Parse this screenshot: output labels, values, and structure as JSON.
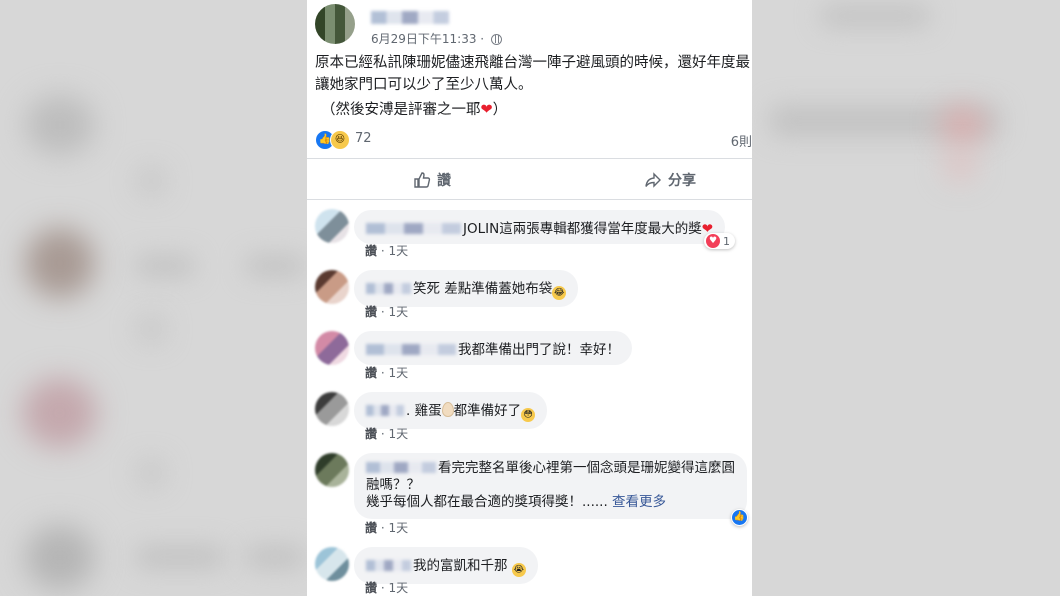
{
  "post": {
    "timestamp": "6月29日下午11:33 · ",
    "text_line1": "原本已經私訊陳珊妮儘速飛離台灣一陣子避風頭的時候，還好年度最",
    "text_line2": "讓她家門口可以少了至少八萬人。",
    "text_line3": "（然後安溥是評審之一耶",
    "text_line3_end": "）",
    "heart_glyph": "❤",
    "reaction_count": "72",
    "share_count": "6則"
  },
  "actions": {
    "like_label": "讚",
    "share_label": "分享"
  },
  "comments": [
    {
      "text": "JOLIN這兩張專輯都獲得當年度最大的獎",
      "emoji": "❤",
      "like": "讚",
      "time": "1天",
      "reacts": "1"
    },
    {
      "text": "笑死 差點準備蓋她布袋",
      "emoji": "😂",
      "like": "讚",
      "time": "1天"
    },
    {
      "text": "我都準備出門了說！幸好！",
      "like": "讚",
      "time": "1天"
    },
    {
      "text_a": ". 雞蛋",
      "text_b": "都準備好了",
      "emoji": "😳",
      "like": "讚",
      "time": "1天"
    },
    {
      "text_line1": "看完完整名單後心裡第一個念頭是珊妮變得這麼圓",
      "text_line2": "融嗎？？",
      "text_line3": "幾乎每個人都在最合適的獎項得獎！......",
      "see_more": "查看更多",
      "like": "讚",
      "time": "1天"
    },
    {
      "text": "我的富凱和千那",
      "emoji": "😭",
      "like": "讚",
      "time": "1天"
    }
  ],
  "colors": {
    "facebook_blue": "#1877f2",
    "heart_red": "#e81f2e",
    "link_blue": "#385898"
  }
}
